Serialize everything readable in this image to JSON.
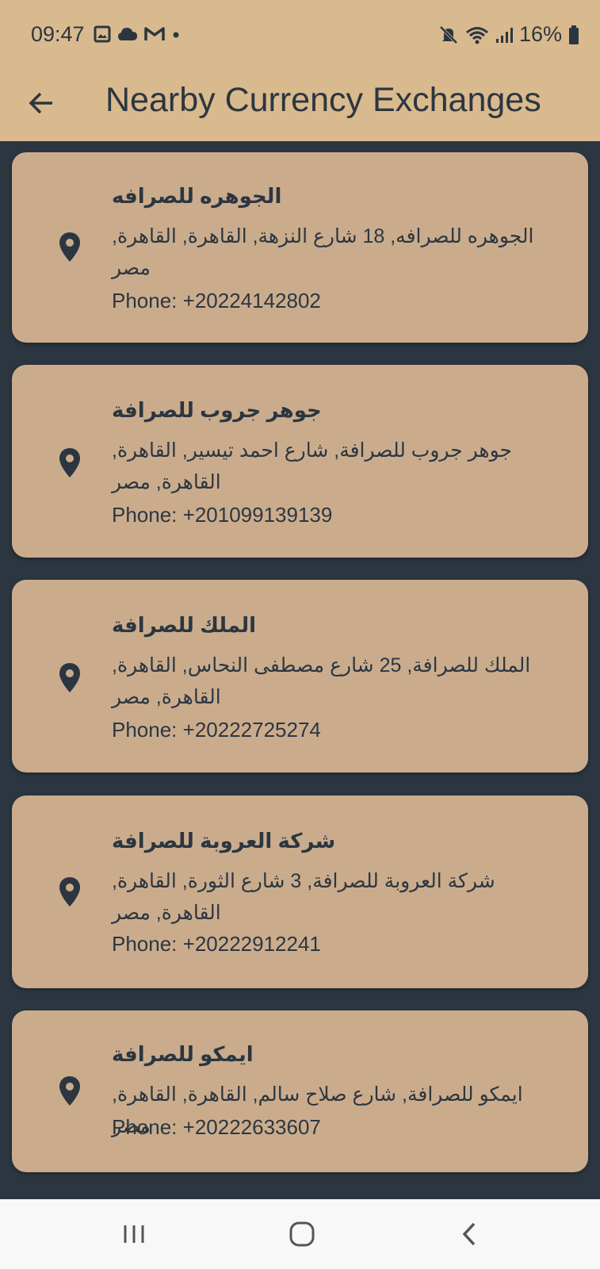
{
  "status_bar": {
    "time": "09:47",
    "battery": "16%",
    "left_icons": [
      "image-icon",
      "cloud-icon",
      "gmail-icon",
      "dot-icon"
    ],
    "right_icons": [
      "mute-icon",
      "wifi-icon",
      "signal-icon",
      "battery-icon"
    ]
  },
  "app_bar": {
    "title": "Nearby Currency Exchanges",
    "back_icon": "arrow-left-icon"
  },
  "exchanges": [
    {
      "name": "الجوهره للصرافه",
      "address": "الجوهره للصرافه, 18 شارع النزهة, القاهرة, القاهرة, مصر",
      "phone": "Phone: +20224142802"
    },
    {
      "name": "جوهر جروب للصرافة",
      "address": "جوهر جروب للصرافة, شارع احمد تيسير, القاهرة, القاهرة, مصر",
      "phone": "Phone: +201099139139"
    },
    {
      "name": "الملك للصرافة",
      "address": "الملك للصرافة, 25 شارع مصطفى النحاس, القاهرة, القاهرة, مصر",
      "phone": "Phone: +20222725274"
    },
    {
      "name": "شركة العروبة للصرافة",
      "address": "شركة العروبة للصرافة, 3 شارع الثورة, القاهرة, القاهرة, مصر",
      "phone": "Phone: +20222912241"
    },
    {
      "name": "ايمكو للصرافة",
      "address": "ايمكو للصرافة, شارع صلاح سالم, القاهرة, القاهرة, مصر",
      "phone": "Phone: +20222633607"
    }
  ],
  "nav_bar": {
    "icons": [
      "recent-apps-icon",
      "home-icon",
      "back-icon"
    ]
  },
  "colors": {
    "header_bg": "#d9b98e",
    "page_bg": "#2c3640",
    "card_bg": "#caac8d",
    "text": "#2c3640"
  }
}
